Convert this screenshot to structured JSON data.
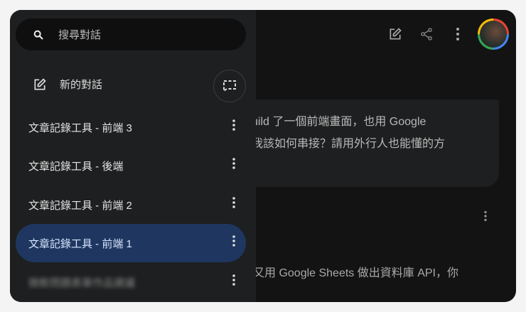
{
  "sidebar": {
    "search_placeholder": "搜尋對話",
    "new_chat": "新的對話",
    "items": [
      {
        "label": "文章記錄工具 - 前端 3"
      },
      {
        "label": "文章記錄工具 - 後端"
      },
      {
        "label": "文章記錄工具 - 前端 2"
      },
      {
        "label": "文章記錄工具 - 前端 1",
        "active": true
      },
      {
        "label": "微軟問題表單作品建議"
      }
    ]
  },
  "chat": {
    "user_line1": "uild 了一個前端畫面，也用 Google",
    "user_line2": " 我該如何串接？請用外行人也能懂的方",
    "response_line": "又用 Google Sheets 做出資料庫 API，你"
  }
}
